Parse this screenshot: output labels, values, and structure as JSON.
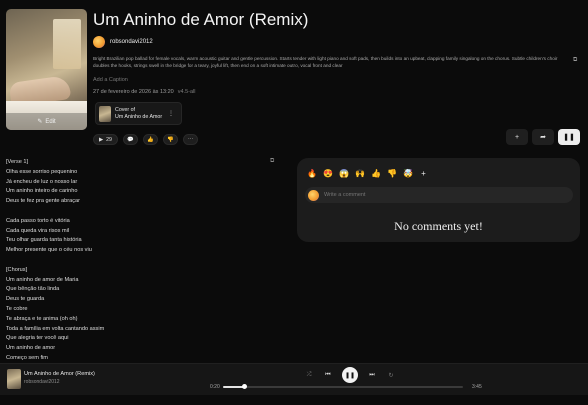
{
  "song": {
    "title": "Um Aninho de Amor (Remix)",
    "username": "robsondavi2012",
    "description": "Bright Brazilian pop ballad for female vocals, warm acoustic guitar and gentle percussion. Starts tender with light piano and soft pads, then builds into an upbeat, clapping family singalong on the chorus. Subtle children's choir doubles the hooks, strings swell in the bridge for a teary, joyful lift, then end on a soft intimate outro, vocal front and clear",
    "caption_placeholder": "Add a Caption",
    "date": "27 de fevereiro de 2026 às 13:20",
    "version": "v4.5-all",
    "edit_label": "Edit"
  },
  "cover_card": {
    "line1": "Cover of",
    "line2": "Um Aninho de Amor"
  },
  "actions": {
    "likes": "29"
  },
  "lyrics": "[Verse 1]\nOlha esse sorriso pequenino\nJá encheu de luz o nosso lar\nUm aninho inteiro de carinho\nDeus te fez pra gente abraçar\n\nCada passo torto é vitória\nCada queda vira risos mil\nTeu olhar guarda tanta história\nMelhor presente que o céu nos viu\n\n[Chorus]\nUm aninho de amor de Maria\nQue bênção tão linda\nDeus te guarda\nTe cobre\nTe abraça e te anima (oh oh)\nToda a família em volta cantando assim\nQue alegria ter você aqui\nUm aninho de amor\nComeço sem fim",
  "comments": {
    "emojis": [
      "🔥",
      "😍",
      "😱",
      "🙌",
      "👍",
      "👎",
      "🤯",
      "+"
    ],
    "placeholder": "Write a comment",
    "empty_text": "No comments yet!"
  },
  "player": {
    "title": "Um Aninho de Amor (Remix)",
    "username": "robsondavi2012",
    "current_time": "0:20",
    "total_time": "3:45",
    "progress": 0.09
  }
}
